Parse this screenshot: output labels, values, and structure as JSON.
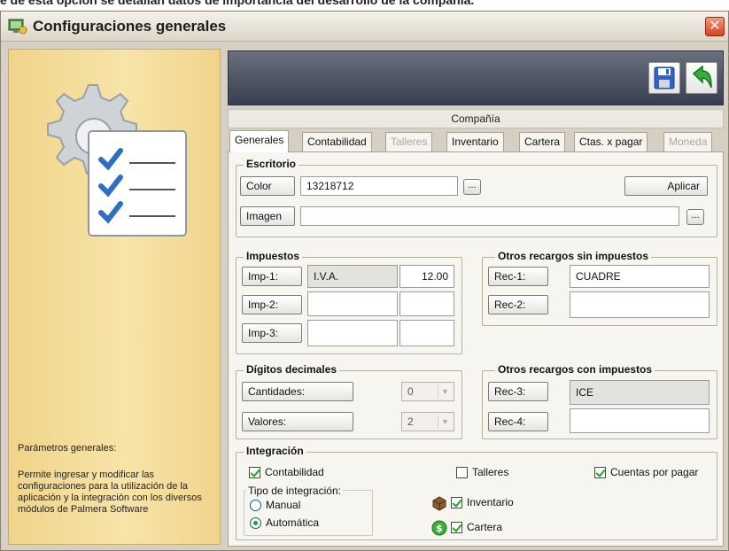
{
  "top_caption": "e de esta opción se detallan datos de importancia del desarrollo de la compañía.",
  "window": {
    "title": "Configuraciones generales",
    "close_glyph": "✕"
  },
  "left_panel": {
    "heading": "Parámetros generales:",
    "description": "Permite ingresar y modificar las configuraciones para la utilización de la aplicación y la integración con los diversos módulos de Palmera Software"
  },
  "company_bar": "Compañía",
  "tabs": [
    {
      "label": "Generales",
      "active": true,
      "enabled": true
    },
    {
      "label": "Contabilidad",
      "active": false,
      "enabled": true
    },
    {
      "label": "Talleres",
      "active": false,
      "enabled": false
    },
    {
      "label": "Inventario",
      "active": false,
      "enabled": true
    },
    {
      "label": "Cartera",
      "active": false,
      "enabled": true
    },
    {
      "label": "Ctas. x pagar",
      "active": false,
      "enabled": true
    },
    {
      "label": "Moneda",
      "active": false,
      "enabled": false
    }
  ],
  "escritorio": {
    "title": "Escritorio",
    "color_button": "Color",
    "color_value": "13218712",
    "browse_label": "...",
    "apply_button": "Aplicar",
    "image_button": "Imagen",
    "image_value": ""
  },
  "impuestos": {
    "title": "Impuestos",
    "rows": [
      {
        "button": "Imp-1:",
        "name": "I.V.A.",
        "value": "12.00"
      },
      {
        "button": "Imp-2:",
        "name": "",
        "value": ""
      },
      {
        "button": "Imp-3:",
        "name": "",
        "value": ""
      }
    ]
  },
  "recargos_sin": {
    "title": "Otros recargos sin impuestos",
    "rows": [
      {
        "button": "Rec-1:",
        "value": "CUADRE"
      },
      {
        "button": "Rec-2:",
        "value": ""
      }
    ]
  },
  "digitos": {
    "title": "Dígitos decimales",
    "rows": [
      {
        "button": "Cantidades:",
        "value": "0"
      },
      {
        "button": "Valores:",
        "value": "2"
      }
    ],
    "dropdown_arrow": "▼"
  },
  "recargos_con": {
    "title": "Otros recargos con impuestos",
    "rows": [
      {
        "button": "Rec-3:",
        "value": "ICE"
      },
      {
        "button": "Rec-4:",
        "value": ""
      }
    ]
  },
  "integracion": {
    "title": "Integración",
    "contabilidad": {
      "label": "Contabilidad",
      "checked": true
    },
    "talleres": {
      "label": "Talleres",
      "checked": false
    },
    "cuentas_por_pagar": {
      "label": "Cuentas por pagar",
      "checked": true
    },
    "inventario": {
      "label": "Inventario",
      "checked": true
    },
    "cartera": {
      "label": "Cartera",
      "checked": true
    },
    "tipo": {
      "label": "Tipo de integración:",
      "manual": "Manual",
      "automatica": "Automática",
      "selected": "automatica"
    }
  },
  "colors": {
    "left_panel": "#f3d98f",
    "header": "#4a4f60",
    "accent_green": "#21a121",
    "close_red": "#d8401e"
  },
  "icons": {
    "title": "settings-monitor-icon",
    "save": "floppy-disk-icon",
    "exit": "green-arrow-exit-icon",
    "hero": "gear-checklist-icon",
    "inventario": "box-icon",
    "cartera": "money-icon"
  }
}
